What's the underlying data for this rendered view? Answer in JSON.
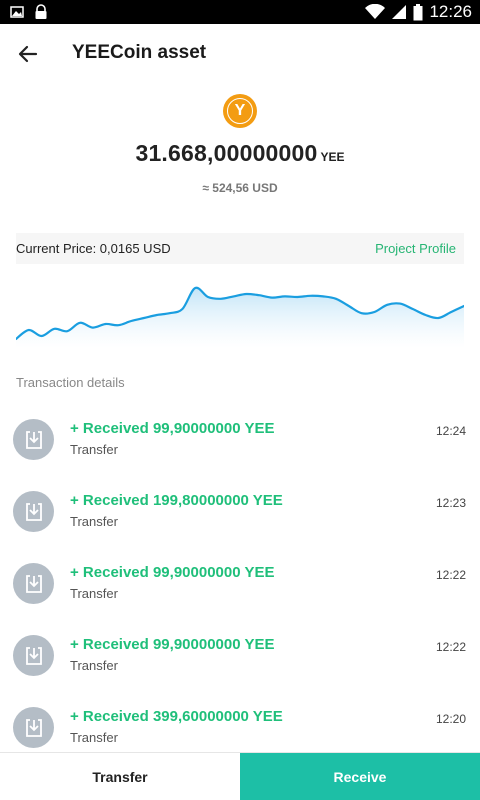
{
  "status_bar": {
    "time": "12:26",
    "icons": [
      "image-icon",
      "lock-icon",
      "wifi-icon",
      "signal-icon",
      "battery-icon"
    ]
  },
  "header": {
    "title": "YEECoin asset",
    "back_icon": "back-arrow-icon"
  },
  "coin": {
    "logo_letter": "Y",
    "logo_color": "#f39c12"
  },
  "balance": {
    "amount": "31.668,00000000",
    "unit": "YEE",
    "fiat": "≈ 524,56 USD"
  },
  "price": {
    "label": "Current Price: 0,0165 USD",
    "project_link": "Project Profile"
  },
  "price_trend": [
    0.05,
    0.2,
    0.1,
    0.22,
    0.18,
    0.32,
    0.24,
    0.3,
    0.28,
    0.35,
    0.4,
    0.45,
    0.48,
    0.55,
    0.9,
    0.75,
    0.72,
    0.76,
    0.8,
    0.78,
    0.74,
    0.76,
    0.75,
    0.77,
    0.76,
    0.72,
    0.6,
    0.48,
    0.5,
    0.62,
    0.64,
    0.55,
    0.45,
    0.4,
    0.5,
    0.6
  ],
  "section_title": "Transaction details",
  "transactions": [
    {
      "title": "+ Received 99,90000000 YEE",
      "type": "Transfer",
      "time": "12:24"
    },
    {
      "title": "+ Received 199,80000000 YEE",
      "type": "Transfer",
      "time": "12:23"
    },
    {
      "title": "+ Received 99,90000000 YEE",
      "type": "Transfer",
      "time": "12:22"
    },
    {
      "title": "+ Received 99,90000000 YEE",
      "type": "Transfer",
      "time": "12:22"
    },
    {
      "title": "+ Received 399,60000000 YEE",
      "type": "Transfer",
      "time": "12:20"
    }
  ],
  "footer": {
    "transfer_label": "Transfer",
    "receive_label": "Receive"
  },
  "colors": {
    "accent_green": "#1fbf7a",
    "receive_button": "#1dbfa6",
    "chart_line": "#1a9ee0"
  }
}
